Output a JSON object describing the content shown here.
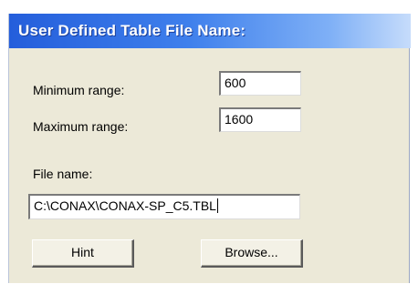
{
  "dialog": {
    "title": "User Defined Table File Name:"
  },
  "range": {
    "minimum_label": "Minimum range:",
    "minimum_value": "600",
    "maximum_label": "Maximum range:",
    "maximum_value": "1600"
  },
  "file": {
    "label": "File name:",
    "value": "C:\\CONAX\\CONAX-SP_C5.TBL"
  },
  "buttons": {
    "hint_label": "Hint",
    "browse_label": "Browse..."
  }
}
